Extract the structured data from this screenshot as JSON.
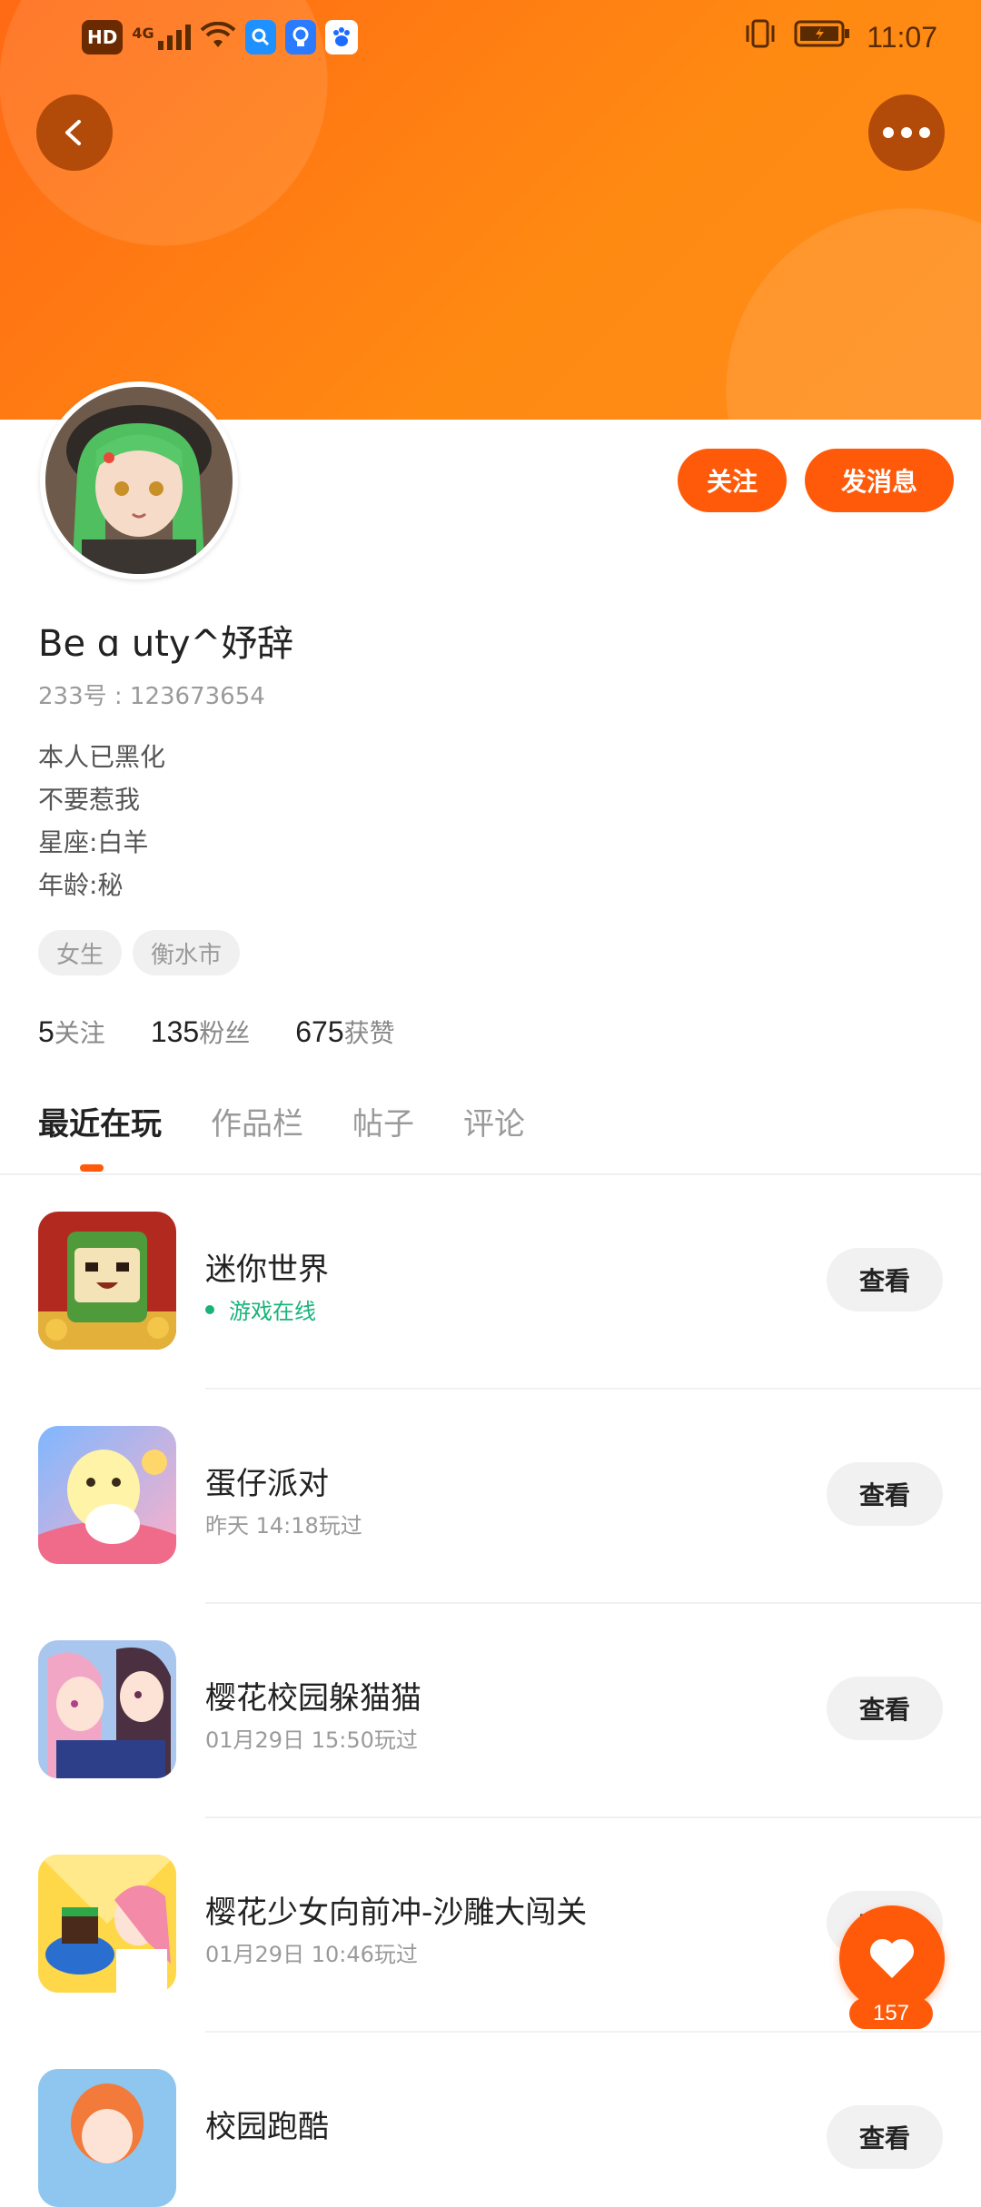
{
  "status_bar": {
    "hd": "HD",
    "network": "4G",
    "time": "11:07"
  },
  "profile": {
    "username": "Be ɑ uty^妤辞",
    "id_text": "233号 : 123673654",
    "bio": [
      "本人已黑化",
      "不要惹我",
      "星座:白羊",
      "年龄:秘"
    ],
    "tags": [
      "女生",
      "衡水市"
    ],
    "stats": [
      {
        "num": "5",
        "label": "关注"
      },
      {
        "num": "135",
        "label": "粉丝"
      },
      {
        "num": "675",
        "label": "获赞"
      }
    ]
  },
  "actions": {
    "follow": "关注",
    "message": "发消息"
  },
  "tabs": [
    "最近在玩",
    "作品栏",
    "帖子",
    "评论"
  ],
  "games": [
    {
      "name": "迷你世界",
      "sub": "游戏在线",
      "online": true,
      "button": "查看"
    },
    {
      "name": "蛋仔派对",
      "sub": "昨天 14:18玩过",
      "online": false,
      "button": "查看"
    },
    {
      "name": "樱花校园躲猫猫",
      "sub": "01月29日 15:50玩过",
      "online": false,
      "button": "查看"
    },
    {
      "name": "樱花少女向前冲-沙雕大闯关",
      "sub": "01月29日 10:46玩过",
      "online": false,
      "button": "查看"
    },
    {
      "name": "校园跑酷",
      "sub": "",
      "online": false,
      "button": "查看"
    }
  ],
  "like": {
    "count": "157"
  },
  "colors": {
    "accent": "#ff5a0a",
    "header_start": "#ff6a14",
    "header_end": "#ff8c1a",
    "online_green": "#19b37a"
  }
}
